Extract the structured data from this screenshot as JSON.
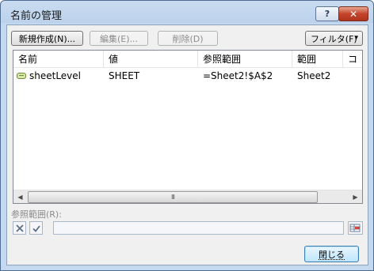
{
  "window": {
    "title": "名前の管理"
  },
  "titlebar": {
    "help_label": "?",
    "close_label": "✕"
  },
  "toolbar": {
    "new_label": "新規作成(N)...",
    "edit_label": "編集(E)...",
    "delete_label": "削除(D)",
    "filter_label": "フィルタ(F)",
    "filter_caret": "▾"
  },
  "list": {
    "columns": [
      "名前",
      "値",
      "参照範囲",
      "範囲",
      "コ"
    ],
    "rows": [
      {
        "icon": "named-range-icon",
        "name": "sheetLevel",
        "value": "SHEET",
        "refers_to": "=Sheet2!$A$2",
        "scope": "Sheet2"
      }
    ],
    "scroll_left": "◀",
    "scroll_right": "▶",
    "thumb_grip": "III"
  },
  "reference": {
    "label": "参照範囲(R):",
    "value": ""
  },
  "footer": {
    "close_label": "閉じる"
  }
}
